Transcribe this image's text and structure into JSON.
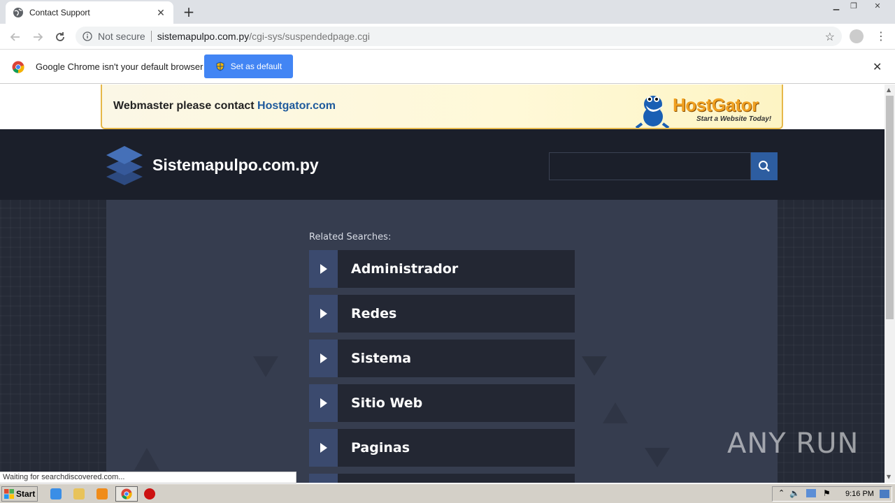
{
  "browser": {
    "tab_title": "Contact Support",
    "new_tab": "+",
    "url_security": "Not secure",
    "url_host": "sistemapulpo.com.py",
    "url_path": "/cgi-sys/suspendedpage.cgi"
  },
  "infobar": {
    "message": "Google Chrome isn't your default browser",
    "button_label": "Set as default"
  },
  "banner": {
    "text": "Webmaster please contact ",
    "link": "Hostgator.com",
    "brand": "HostGator",
    "tagline": "Start a Website Today!"
  },
  "site": {
    "name": "Sistemapulpo.com.py",
    "search_placeholder": ""
  },
  "related": {
    "title": "Related Searches:",
    "items": [
      {
        "label": "Administrador"
      },
      {
        "label": "Redes"
      },
      {
        "label": "Sistema"
      },
      {
        "label": "Sitio Web"
      },
      {
        "label": "Paginas"
      }
    ]
  },
  "status": {
    "text": "Waiting for searchdiscovered.com..."
  },
  "watermark": "ANY RUN",
  "taskbar": {
    "start_label": "Start",
    "clock": "9:16 PM"
  },
  "colors": {
    "header_bg": "#1b1f2a",
    "content_bg": "#363d4f",
    "item_bg": "#232733",
    "arrow_bg": "#3b4a6e",
    "search_btn": "#2d5da0",
    "chrome_blue": "#4285f4"
  }
}
